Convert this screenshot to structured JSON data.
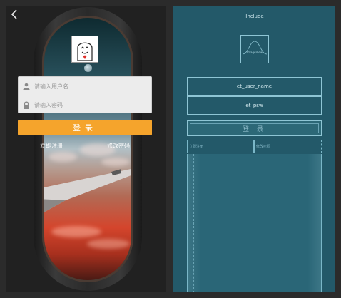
{
  "design": {
    "back_icon": "back-arrow-icon",
    "avatar_icon": "ghost-avatar-icon",
    "username_placeholder": "请输入用户名",
    "password_placeholder": "请输入密码",
    "username_icon": "user-icon",
    "password_icon": "lock-icon",
    "login_label": "登录",
    "register_label": "立即注册",
    "change_password_label": "修改密码",
    "login_color": "#f5a42c"
  },
  "blueprint": {
    "include_label": "Include",
    "imageview_label": "ImageView",
    "username_id": "et_user_name",
    "password_id": "et_psw",
    "login_label": "登 录",
    "register_label": "立即注册",
    "change_password_label": "修改密码",
    "background_color": "#235969"
  }
}
